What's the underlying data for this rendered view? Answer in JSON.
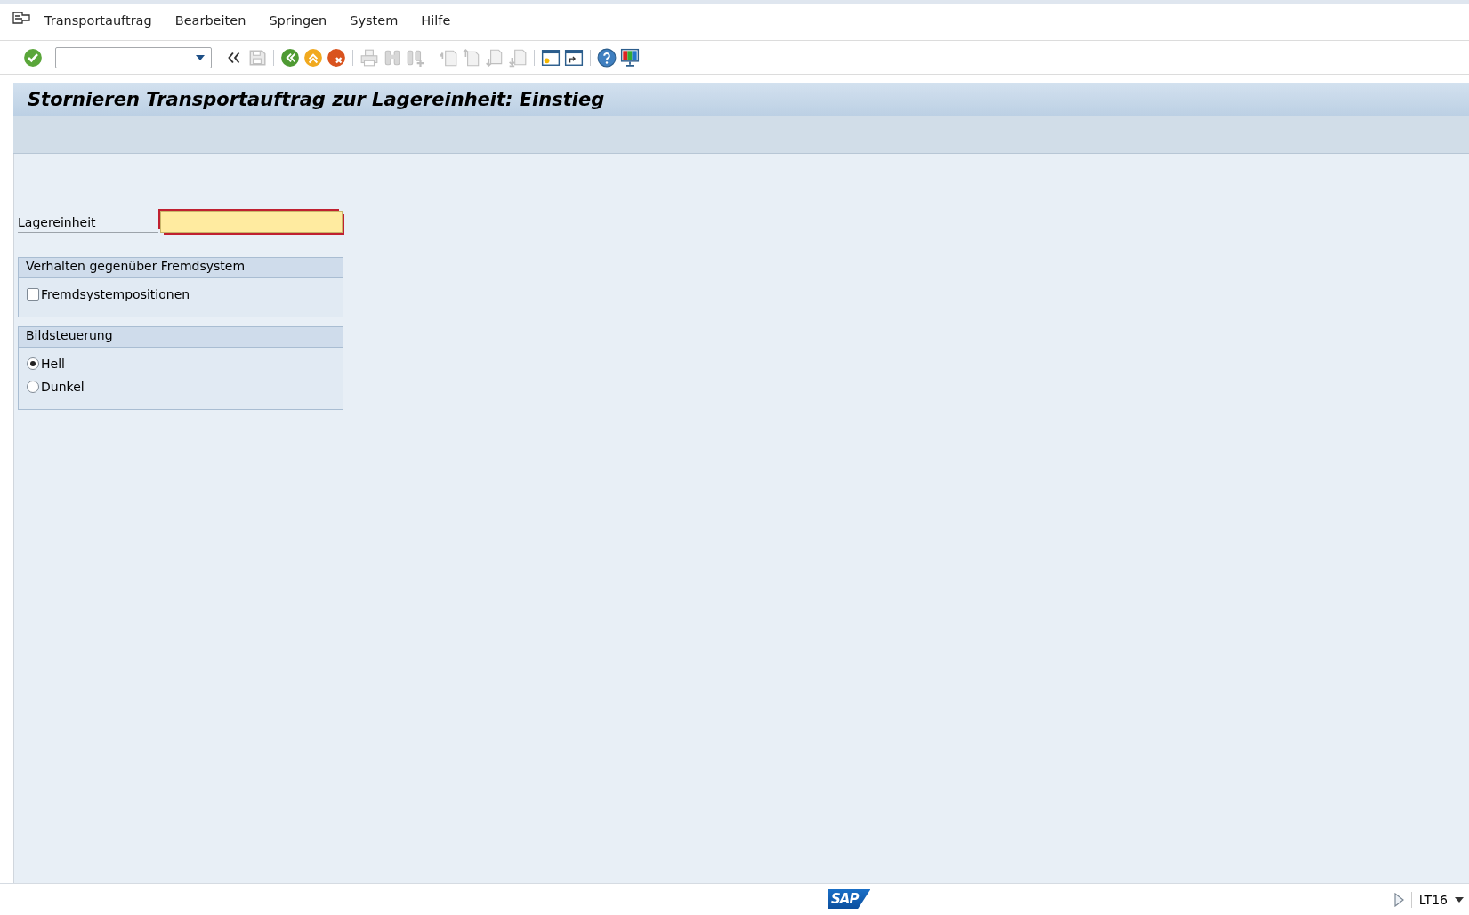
{
  "menu": [
    {
      "label": "Transportauftrag"
    },
    {
      "label": "Bearbeiten"
    },
    {
      "label": "Springen"
    },
    {
      "label": "System"
    },
    {
      "label": "Hilfe"
    }
  ],
  "toolbar": [
    {
      "kind": "ok",
      "disabled": false
    },
    {
      "kind": "command-field",
      "disabled": false
    },
    {
      "kind": "collapse",
      "disabled": false
    },
    {
      "kind": "save",
      "disabled": true
    },
    {
      "kind": "separator"
    },
    {
      "kind": "back",
      "disabled": false
    },
    {
      "kind": "exit",
      "disabled": false
    },
    {
      "kind": "cancel",
      "disabled": false
    },
    {
      "kind": "separator"
    },
    {
      "kind": "print",
      "disabled": true
    },
    {
      "kind": "find",
      "disabled": true
    },
    {
      "kind": "find-next",
      "disabled": true
    },
    {
      "kind": "separator"
    },
    {
      "kind": "first-page",
      "disabled": true
    },
    {
      "kind": "previous-page",
      "disabled": true
    },
    {
      "kind": "next-page",
      "disabled": true
    },
    {
      "kind": "last-page",
      "disabled": true
    },
    {
      "kind": "separator"
    },
    {
      "kind": "new-session",
      "disabled": false
    },
    {
      "kind": "shortcut",
      "disabled": false
    },
    {
      "kind": "separator"
    },
    {
      "kind": "help",
      "disabled": false
    },
    {
      "kind": "layout",
      "disabled": false
    }
  ],
  "title": "Stornieren Transportauftrag zur Lagereinheit: Einstieg",
  "fields": [
    {
      "label": "Lagereinheit",
      "required": true
    }
  ],
  "groups": [
    {
      "title": "Verhalten gegenüber Fremdsystem",
      "options": [
        {
          "kind": "checkbox",
          "label": "Fremdsystempositionen",
          "checked": false
        }
      ]
    },
    {
      "title": "Bildsteuerung",
      "options": [
        {
          "kind": "radio",
          "label": "Hell",
          "selected": true
        },
        {
          "kind": "radio",
          "label": "Dunkel",
          "selected": false
        }
      ]
    }
  ],
  "status_bar": {
    "logo": "SAP",
    "transaction": "LT16"
  }
}
